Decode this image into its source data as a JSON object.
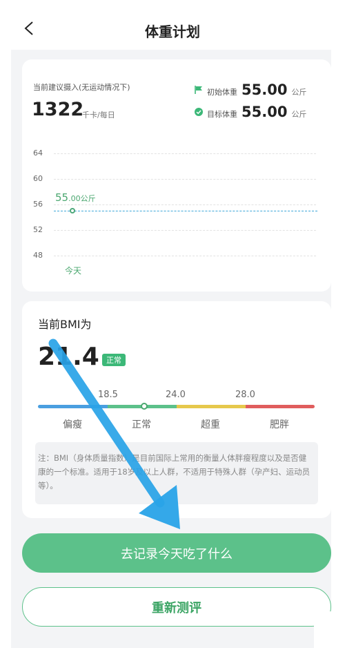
{
  "header": {
    "title": "体重计划"
  },
  "plan_card": {
    "intake_label": "当前建议摄入(无运动情况下)",
    "intake_value": "1322",
    "intake_unit": "千卡/每日",
    "initial_weight": {
      "label": "初始体重",
      "value": "55.00",
      "unit": "公斤"
    },
    "target_weight": {
      "label": "目标体重",
      "value": "55.00",
      "unit": "公斤"
    },
    "chart": {
      "y_ticks": [
        "64",
        "60",
        "56",
        "52",
        "48"
      ],
      "current_value": "55",
      "current_decimal": ".00",
      "current_unit": "公斤",
      "x_label": "今天"
    }
  },
  "chart_data": {
    "type": "line",
    "x": [
      "今天"
    ],
    "series": [
      {
        "values": [
          55.0
        ]
      }
    ],
    "ylim": [
      48,
      64
    ],
    "y_ticks": [
      64,
      60,
      56,
      52,
      48
    ],
    "target_line": 55.0,
    "grid": true,
    "colors": {
      "point": "#4ca87a",
      "target": "#3ca6d9"
    }
  },
  "bmi_card": {
    "title": "当前BMI为",
    "value": "21.4",
    "badge": "正常",
    "scale_numbers": [
      "18.5",
      "24.0",
      "28.0"
    ],
    "categories": [
      "偏瘦",
      "正常",
      "超重",
      "肥胖"
    ],
    "colors": [
      "#4a9fe0",
      "#5cc18a",
      "#e6c84c",
      "#e05d5d"
    ],
    "note": "注：BMI（身体质量指数）是目前国际上常用的衡量人体胖瘦程度以及是否健康的一个标准。适用于18岁及以上人群，不适用于特殊人群（孕产妇、运动员等）。"
  },
  "actions": {
    "primary": "去记录今天吃了什么",
    "secondary": "重新测评"
  },
  "theme": {
    "accent": "#5cc18a",
    "annotation_arrow": "#29a3e8"
  }
}
